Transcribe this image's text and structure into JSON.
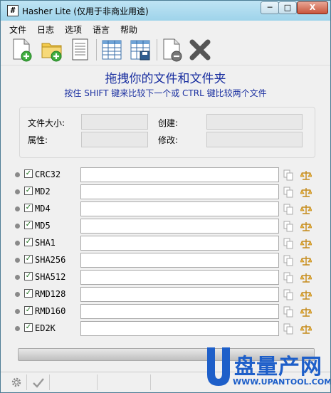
{
  "window": {
    "title": "Hasher Lite (仅用于非商业用途)",
    "app_icon_glyph": "#",
    "min_glyph": "─",
    "max_glyph": "□",
    "close_glyph": "X"
  },
  "menu": [
    {
      "label": "文件"
    },
    {
      "label": "日志"
    },
    {
      "label": "选项"
    },
    {
      "label": "语言"
    },
    {
      "label": "帮助"
    }
  ],
  "toolbar": {
    "icons": [
      "add-file-icon",
      "add-folder-icon",
      "document-icon",
      "table-icon",
      "save-table-icon",
      "remove-file-icon",
      "clear-icon"
    ]
  },
  "drop": {
    "title": "拖拽你的文件和文件夹",
    "hint": "按住 SHIFT 键来比较下一个或 CTRL 键比较两个文件"
  },
  "info": {
    "size_label": "文件大小:",
    "attr_label": "属性:",
    "created_label": "创建:",
    "modified_label": "修改:",
    "size_value": "",
    "attr_value": "",
    "created_value": "",
    "modified_value": ""
  },
  "hashes": [
    {
      "name": "CRC32",
      "checked": true,
      "value": ""
    },
    {
      "name": "MD2",
      "checked": true,
      "value": ""
    },
    {
      "name": "MD4",
      "checked": true,
      "value": ""
    },
    {
      "name": "MD5",
      "checked": true,
      "value": ""
    },
    {
      "name": "SHA1",
      "checked": true,
      "value": ""
    },
    {
      "name": "SHA256",
      "checked": true,
      "value": ""
    },
    {
      "name": "SHA512",
      "checked": true,
      "value": ""
    },
    {
      "name": "RMD128",
      "checked": true,
      "value": ""
    },
    {
      "name": "RMD160",
      "checked": true,
      "value": ""
    },
    {
      "name": "ED2K",
      "checked": true,
      "value": ""
    }
  ],
  "progress": {
    "value": 0
  },
  "status": {
    "icons": [
      "gear-icon",
      "checkmark-icon"
    ]
  },
  "watermark": {
    "logo_letter": "U",
    "brand": "盘量产网",
    "site": "WWW.UPANTOOL.COM"
  },
  "colors": {
    "title_blue": "#1a2fa0",
    "titlebar": "#a9d8ee",
    "close_red": "#c8553b",
    "watermark_blue": "#1e5fc9"
  }
}
